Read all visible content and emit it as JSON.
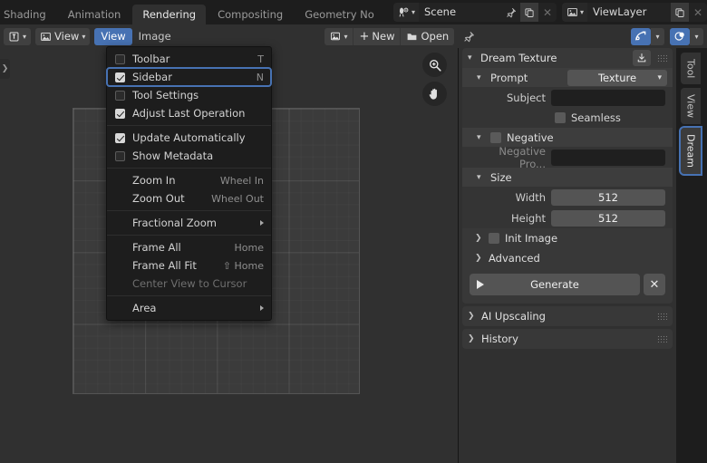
{
  "workspace_tabs": [
    {
      "label": "Shading",
      "active": false,
      "clipped": true
    },
    {
      "label": "Animation",
      "active": false
    },
    {
      "label": "Rendering",
      "active": true
    },
    {
      "label": "Compositing",
      "active": false
    },
    {
      "label": "Geometry No",
      "active": false,
      "clipped_right": true
    }
  ],
  "topbar": {
    "scene": {
      "name": "Scene",
      "icon": "scene-icon",
      "pin_icon": "pin-icon",
      "duplicate_icon": "duplicate-icon",
      "close_icon": "x-icon"
    },
    "viewlayer": {
      "name": "ViewLayer",
      "icon": "viewlayer-icon",
      "duplicate_icon": "duplicate-icon",
      "close_icon": "x-icon"
    }
  },
  "editor_header": {
    "editor_type_icon": "image-editor-icon",
    "mode_label": "View",
    "menus": [
      {
        "label": "View",
        "open": true
      },
      {
        "label": "Image",
        "open": false
      }
    ],
    "image_datablock_icon": "image-icon",
    "new_label": "New",
    "open_label": "Open",
    "pin_icon": "pin-icon",
    "gizmo_toggle_icon": "gizmo-icon",
    "overlay_toggle_icon": "overlays-icon"
  },
  "view_menu": {
    "items": [
      {
        "type": "check",
        "label": "Toolbar",
        "checked": false,
        "shortcut": "T",
        "underline": "",
        "selected": false
      },
      {
        "type": "check",
        "label": "Sidebar",
        "checked": true,
        "shortcut": "N",
        "underline": "",
        "selected": true
      },
      {
        "type": "check",
        "label": "Tool Settings",
        "checked": false,
        "shortcut": "",
        "selected": false
      },
      {
        "type": "check",
        "label": "Adjust Last Operation",
        "checked": true,
        "shortcut": "",
        "selected": false
      },
      {
        "type": "separator"
      },
      {
        "type": "check",
        "label": "Update Automatically",
        "checked": true,
        "shortcut": "",
        "selected": false
      },
      {
        "type": "check",
        "label": "Show Metadata",
        "checked": false,
        "shortcut": "",
        "selected": false
      },
      {
        "type": "separator"
      },
      {
        "type": "item",
        "label": "Zoom In",
        "shortcut": "Wheel In",
        "underline_index": 0
      },
      {
        "type": "item",
        "label": "Zoom Out",
        "shortcut": "Wheel Out",
        "underline_index": 5
      },
      {
        "type": "separator"
      },
      {
        "type": "submenu",
        "label": "Fractional Zoom",
        "underline_index": 0
      },
      {
        "type": "separator"
      },
      {
        "type": "item",
        "label": "Frame All",
        "shortcut": "Home",
        "underline_index": 6
      },
      {
        "type": "item",
        "label": "Frame All Fit",
        "shortcut": "⇧ Home",
        "underline_index": 2
      },
      {
        "type": "item",
        "label": "Center View to Cursor",
        "shortcut": "",
        "disabled": true,
        "underline_index": 8
      },
      {
        "type": "separator"
      },
      {
        "type": "submenu",
        "label": "Area",
        "underline_index": 3
      }
    ]
  },
  "canvas": {
    "toolbar_arrow_icon": "chevron-right-icon",
    "gizmos": [
      {
        "name": "zoom-in-icon"
      },
      {
        "name": "pan-hand-icon"
      }
    ]
  },
  "sidebar": {
    "dream_texture": {
      "title": "Dream Texture",
      "expand_icon": "chevron-down-icon",
      "download_icon": "download-icon",
      "grip_icon": "grip-dots-icon",
      "prompt": {
        "title": "Prompt",
        "expand_icon": "chevron-down-icon",
        "preset_value": "Texture",
        "preset_options": [
          "Texture"
        ],
        "subject_label": "Subject",
        "subject_value": "",
        "subject_placeholder": "",
        "seamless_label": "Seamless",
        "seamless_checked": false
      },
      "negative": {
        "title": "Negative",
        "expand_icon": "chevron-down-icon",
        "enabled": false,
        "prompt_label": "Negative Pro...",
        "prompt_value": ""
      },
      "size": {
        "title": "Size",
        "expand_icon": "chevron-down-icon",
        "width_label": "Width",
        "width_value": "512",
        "height_label": "Height",
        "height_value": "512"
      },
      "init_image": {
        "label": "Init Image",
        "expand_icon": "chevron-right-icon",
        "enabled": false
      },
      "advanced": {
        "label": "Advanced",
        "expand_icon": "chevron-right-icon"
      },
      "generate": {
        "label": "Generate",
        "play_icon": "play-icon",
        "cancel_icon": "x-icon"
      }
    },
    "panels": [
      {
        "label": "AI Upscaling",
        "expand_icon": "chevron-right-icon",
        "grip_icon": "grip-dots-icon"
      },
      {
        "label": "History",
        "expand_icon": "chevron-right-icon",
        "grip_icon": "grip-dots-icon"
      }
    ]
  },
  "vertical_tabs": [
    {
      "label": "Tool",
      "active": false
    },
    {
      "label": "View",
      "active": false
    },
    {
      "label": "Dream",
      "active": true
    }
  ],
  "colors": {
    "accent_blue": "#4772b3",
    "panel_bg": "#383838",
    "editor_bg": "#303030",
    "window_bg": "#1d1d1d",
    "menu_bg": "#1d1d1d"
  }
}
